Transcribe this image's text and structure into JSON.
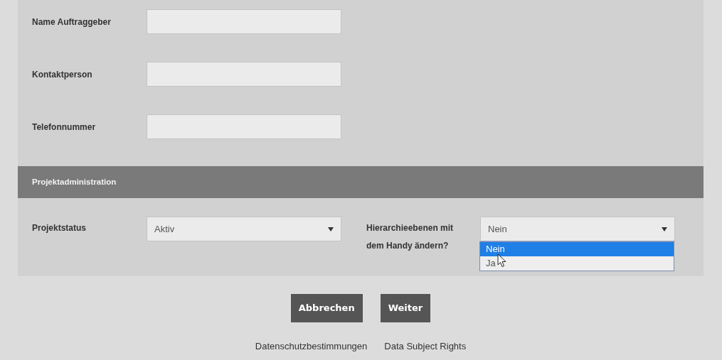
{
  "fields": [
    {
      "label": "Name Auftraggeber"
    },
    {
      "label": "Kontaktperson"
    },
    {
      "label": "Telefonnummer"
    }
  ],
  "section_header": "Projektadministration",
  "selects": [
    {
      "label": "Projektstatus",
      "value": "Aktiv",
      "expanded": false
    },
    {
      "label": "Hierarchieebenen mit dem Handy ändern?",
      "value": "Nein",
      "expanded": true,
      "options": [
        {
          "label": "Nein",
          "selected": true
        },
        {
          "label": "Ja",
          "selected": false
        }
      ]
    }
  ],
  "buttons": [
    "Abbrechen",
    "Weiter"
  ],
  "footer_links": [
    "Datenschutzbestimmungen",
    "Data Subject Rights"
  ]
}
